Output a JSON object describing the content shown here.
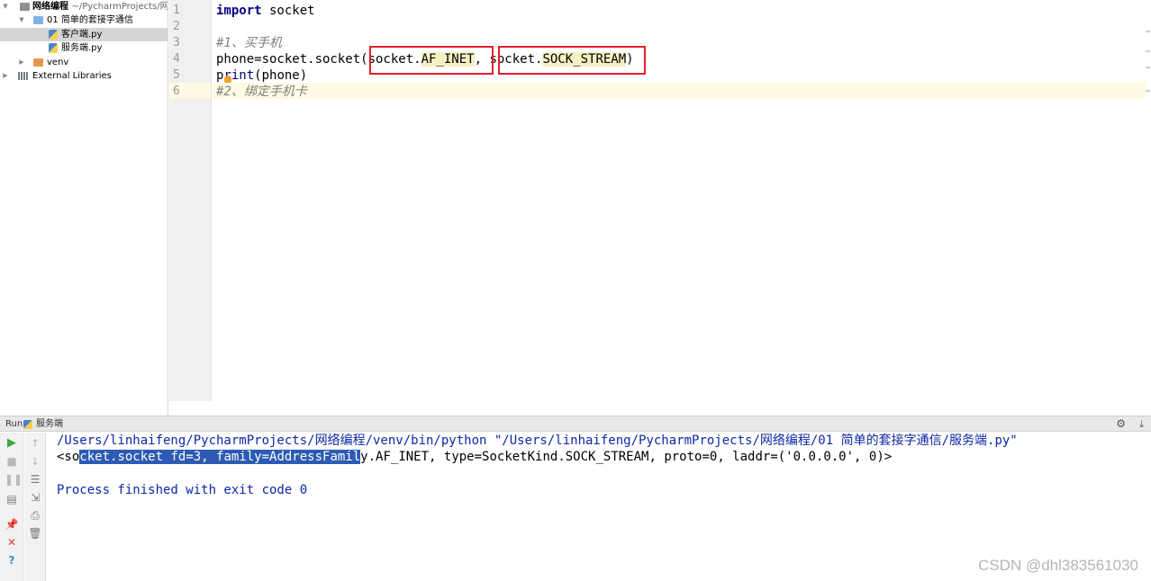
{
  "project_tree": {
    "root_name": "网络编程",
    "root_path": "~/PycharmProjects/网",
    "folder_name": "01 简单的套接字通信",
    "file_client": "客户端.py",
    "file_server": "服务端.py",
    "venv": "venv",
    "external_libraries": "External Libraries"
  },
  "editor": {
    "line_numbers": [
      "1",
      "2",
      "3",
      "4",
      "5",
      "6"
    ],
    "line1_kw": "import",
    "line1_rest": " socket",
    "line3_comment": "#1、买手机",
    "line4_prefix": "phone=socket.socket(socket.",
    "line4_arg1": "AF_INET",
    "line4_mid": ", socket.",
    "line4_arg2": "SOCK_STREAM",
    "line4_suffix": ")",
    "line5_pre": "p",
    "line5_builtin": "rint",
    "line5_rest": "(phone)",
    "line6_comment": "#2、绑定手机卡"
  },
  "run_panel": {
    "title": "Run",
    "tab_label": "服务端",
    "gear_icon": "gear-icon",
    "console_line1": "/Users/linhaifeng/PycharmProjects/网络编程/venv/bin/python \"/Users/linhaifeng/PycharmProjects/网络编程/01 简单的套接字通信/服务端.py\"",
    "console_line2_a": "<so",
    "console_line2_sel": "cket.socket fd=3, family=AddressFamil",
    "console_line2_b": "y.AF_INET, type=SocketKind.SOCK_STREAM, proto=0, laddr=('0.0.0.0', 0)>",
    "console_line4": "Process finished with exit code 0"
  },
  "watermark": "CSDN @dhl383561030",
  "colors": {
    "keyword": "#000080",
    "comment": "#808080",
    "highlight_box": "#e0202a",
    "console_path": "#0d28a8",
    "selection": "#2d5bb4"
  }
}
